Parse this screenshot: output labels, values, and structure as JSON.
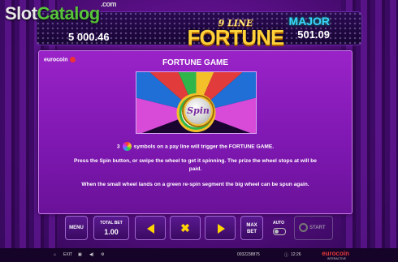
{
  "watermark": {
    "slot": "Slot",
    "catalog": "Catalog",
    "com": ".com"
  },
  "header": {
    "jackpot_left": "5 000.46",
    "logo_small": "9 LINE",
    "logo_big": "FORTUNE",
    "jackpot_right_label": "MAJOR",
    "jackpot_right": "501.09"
  },
  "panel": {
    "provider": "eurocoin",
    "title": "FORTUNE GAME",
    "spin_label": "Spin",
    "line1_a": "3",
    "line1_b": "symbols on a pay line will trigger the FORTUNE GAME.",
    "line2": "Press the Spin button, or swipe the wheel to get it spinning. The prize the wheel stops at will be paid.",
    "line3": "When the small wheel lands on a green re-spin segment the big wheel can be spun again."
  },
  "controls": {
    "menu": "MENU",
    "total_bet_label": "TOTAL BET",
    "total_bet": "1.00",
    "max_bet": "MAX BET",
    "auto": "AUTO",
    "start": "START"
  },
  "bottom": {
    "exit": "EXIT",
    "session": "0032238875",
    "time": "12:26",
    "brand": "eurocoin",
    "brand_sub": "INTERACTIVE"
  },
  "colors": {
    "accent": "#ffd400",
    "panel": "#8a1fba",
    "jackpot_label": "#3ad0ff"
  }
}
